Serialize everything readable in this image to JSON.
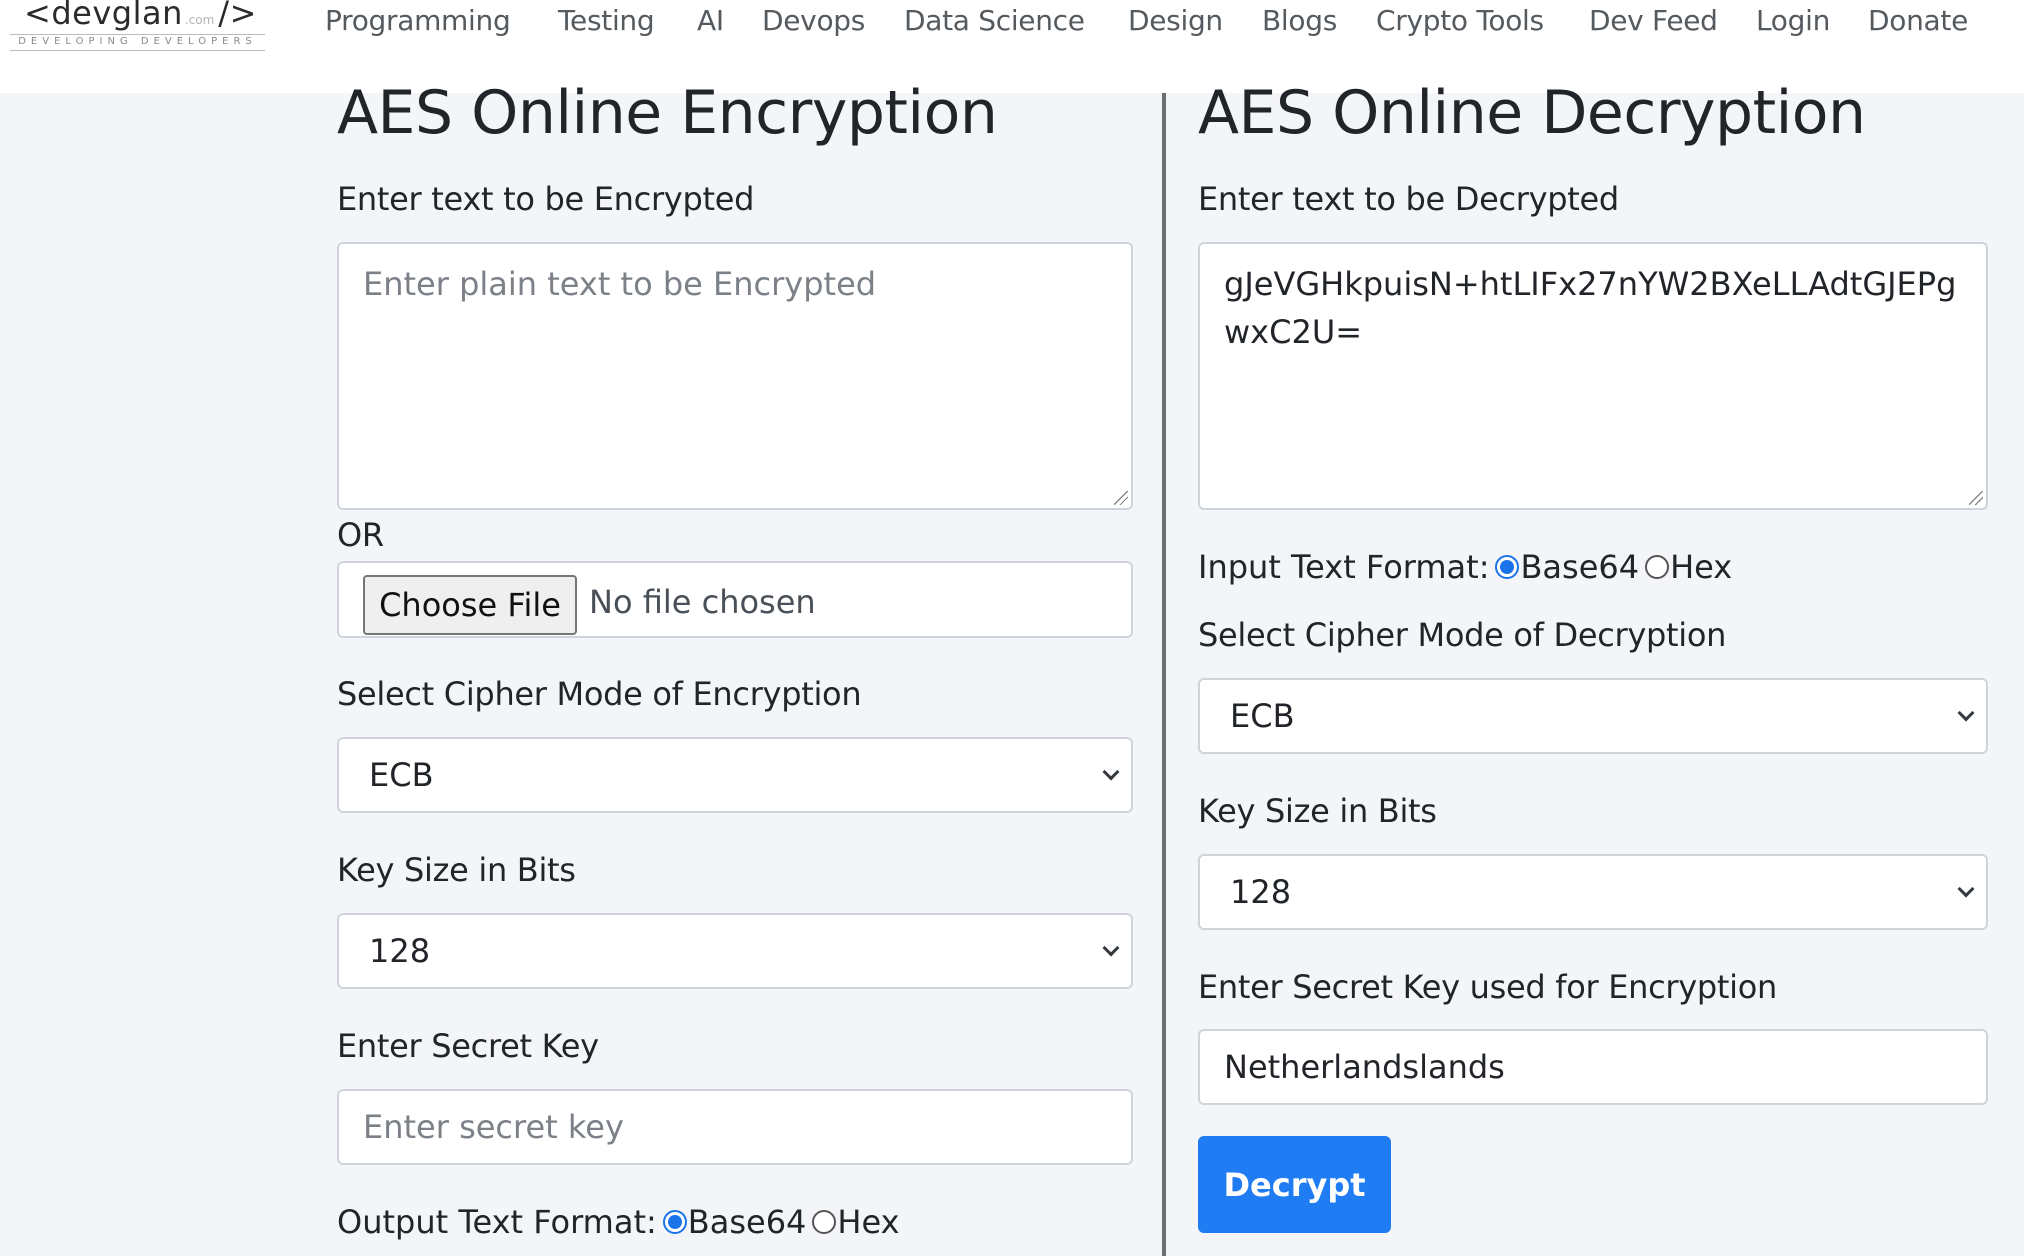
{
  "header": {
    "logo": {
      "main": "<devglan",
      "com": ".com",
      "close": "/>",
      "tagline": "DEVELOPING DEVELOPERS"
    },
    "nav": [
      "Programming",
      "Testing",
      "AI",
      "Devops",
      "Data Science",
      "Design",
      "Blogs",
      "Crypto Tools",
      "Dev Feed",
      "Login",
      "Donate"
    ]
  },
  "encrypt": {
    "title": "AES Online Encryption",
    "text_label": "Enter text to be Encrypted",
    "text_placeholder": "Enter plain text to be Encrypted",
    "text_value": "",
    "or_label": "OR",
    "file_button": "Choose File",
    "file_status": "No file chosen",
    "mode_label": "Select Cipher Mode of Encryption",
    "mode_value": "ECB",
    "keysize_label": "Key Size in Bits",
    "keysize_value": "128",
    "secret_label": "Enter Secret Key",
    "secret_placeholder": "Enter secret key",
    "secret_value": "",
    "output_format_label": "Output Text Format:",
    "format_options": [
      "Base64",
      "Hex"
    ],
    "format_selected": "Base64"
  },
  "decrypt": {
    "title": "AES Online Decryption",
    "text_label": "Enter text to be Decrypted",
    "text_value": "gJeVGHkpuisN+htLIFx27nYW2BXeLLAdtGJEPgwxC2U=",
    "input_format_label": "Input Text Format:",
    "format_options": [
      "Base64",
      "Hex"
    ],
    "format_selected": "Base64",
    "mode_label": "Select Cipher Mode of Decryption",
    "mode_value": "ECB",
    "keysize_label": "Key Size in Bits",
    "keysize_value": "128",
    "secret_label": "Enter Secret Key used for Encryption",
    "secret_value": "Netherlandslands",
    "decrypt_button": "Decrypt"
  },
  "colors": {
    "accent": "#1f7cf2",
    "radio_checked": "#1a73e8",
    "background": "#f4f5f8",
    "divider": "#6c6f72"
  }
}
